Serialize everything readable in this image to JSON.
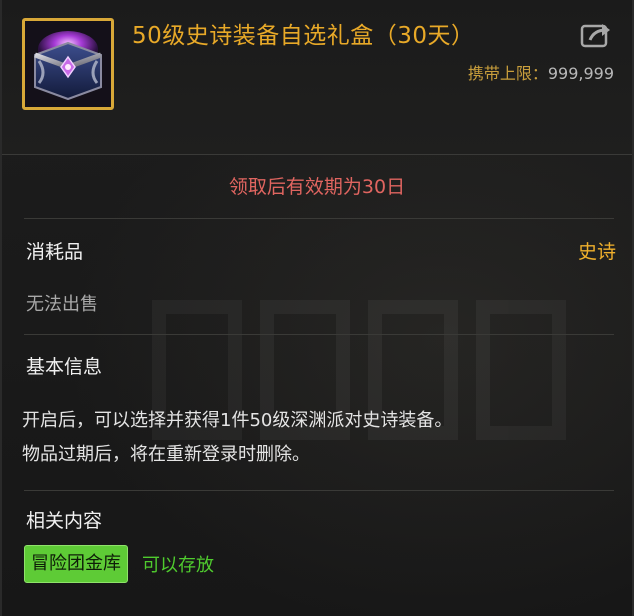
{
  "item": {
    "name": "50级史诗装备自选礼盒（30天）",
    "icon": "epic-gift-box-icon",
    "rarity_color": "#e8a928"
  },
  "header": {
    "carry_limit_label": "携带上限：",
    "carry_limit_value": "999,999",
    "share_icon": "share-icon"
  },
  "expiry_notice": "领取后有效期为30日",
  "attributes": {
    "category": "消耗品",
    "rarity": "史诗",
    "trade_status": "无法出售"
  },
  "basic_info": {
    "title": "基本信息",
    "lines": [
      "开启后，可以选择并获得1件50级深渊派对史诗装备。",
      "物品过期后，将在重新登录时删除。"
    ]
  },
  "related": {
    "title": "相关内容",
    "badge": "冒险团金库",
    "status": "可以存放"
  },
  "colors": {
    "expiry": "#e06560",
    "rarity": "#f0b02c",
    "storage_badge_bg": "#5ecb36",
    "storage_status": "#4fcb2e"
  }
}
